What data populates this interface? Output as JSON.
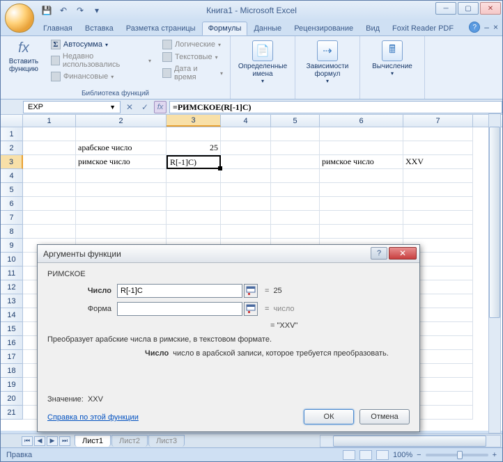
{
  "window": {
    "title": "Книга1 - Microsoft Excel"
  },
  "ribbon_tabs": {
    "home": "Главная",
    "insert": "Вставка",
    "page_layout": "Разметка страницы",
    "formulas": "Формулы",
    "data": "Данные",
    "review": "Рецензирование",
    "view": "Вид",
    "foxit": "Foxit Reader PDF"
  },
  "ribbon": {
    "insert_function": "Вставить функцию",
    "autosum": "Автосумма",
    "recent": "Недавно использовались",
    "financial": "Финансовые",
    "logical": "Логические",
    "text": "Текстовые",
    "datetime": "Дата и время",
    "library_label": "Библиотека функций",
    "defined_names": "Определенные имена",
    "formula_auditing": "Зависимости формул",
    "calculation": "Вычисление"
  },
  "formula_bar": {
    "name_box": "EXP",
    "formula": "=РИМСКОЕ(R[-1]C)"
  },
  "grid": {
    "col_headers": [
      "1",
      "2",
      "3",
      "4",
      "5",
      "6",
      "7"
    ],
    "row_headers": [
      "1",
      "2",
      "3",
      "4",
      "5",
      "6",
      "7",
      "8",
      "9",
      "10",
      "11",
      "12",
      "13",
      "14",
      "15",
      "16",
      "17",
      "18",
      "19",
      "20",
      "21"
    ],
    "active_row": "3",
    "active_col": "3",
    "cells": {
      "r2c2": "арабское число",
      "r2c3": "25",
      "r3c2": "римское число",
      "r3c3": "R[-1]C)",
      "r3c6": "римское число",
      "r3c7": "XXV"
    }
  },
  "dialog": {
    "title": "Аргументы функции",
    "func_name": "РИМСКОЕ",
    "args": {
      "chislo_label": "Число",
      "chislo_value": "R[-1]C",
      "chislo_result": "25",
      "forma_label": "Форма",
      "forma_value": "",
      "forma_result": "число"
    },
    "result_preview": "\"XXV\"",
    "description": "Преобразует арабские числа в римские, в текстовом формате.",
    "arg_desc_label": "Число",
    "arg_desc_text": "число в арабской записи, которое требуется преобразовать.",
    "value_label": "Значение:",
    "value": "XXV",
    "help_link": "Справка по этой функции",
    "ok": "ОК",
    "cancel": "Отмена"
  },
  "sheets": {
    "s1": "Лист1",
    "s2": "Лист2",
    "s3": "Лист3"
  },
  "status": {
    "mode": "Правка",
    "zoom": "100%"
  }
}
